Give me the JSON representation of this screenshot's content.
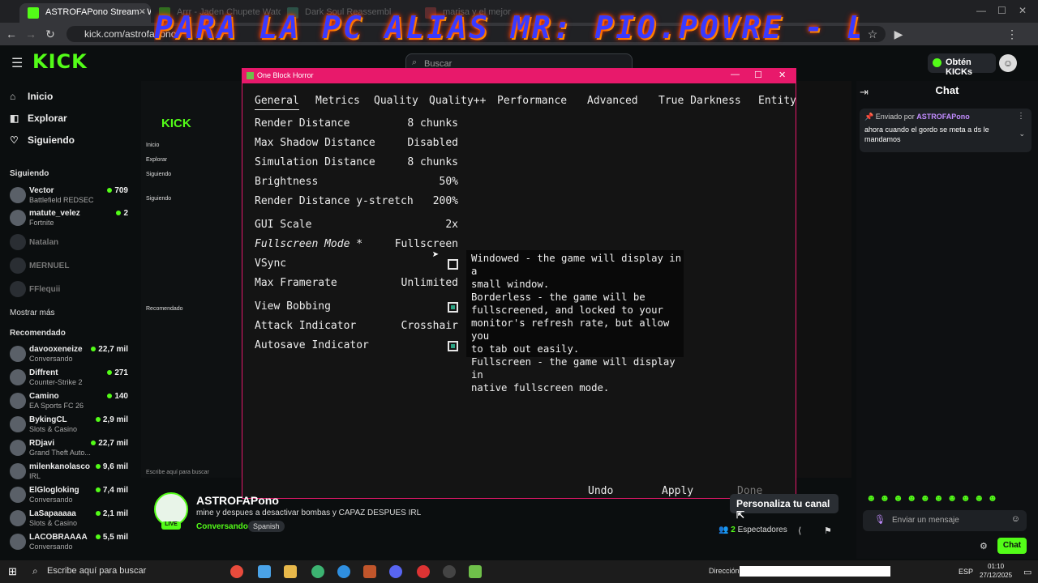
{
  "browser": {
    "tabs": [
      {
        "label": "ASTROFAPono Stream - Watch",
        "active": true
      },
      {
        "label": "Arrr - Jaden Chupete Watch",
        "active": false
      },
      {
        "label": "Dark Soul Reassembl",
        "active": false
      },
      {
        "label": "marisa y el mejor",
        "active": false
      }
    ],
    "url": "kick.com/astrofapono",
    "overlay_banner": "PARA LA PC ALIAS MR: PIO.POVRE - LEANSGIP"
  },
  "kick": {
    "logo": "KICK",
    "search_placeholder": "Buscar",
    "obtain_kicks": "Obtén KICKs",
    "nav": [
      {
        "label": "Inicio",
        "icon": "home-icon"
      },
      {
        "label": "Explorar",
        "icon": "compass-icon"
      },
      {
        "label": "Siguiendo",
        "icon": "heart-icon"
      }
    ],
    "following_header": "Siguiendo",
    "following": [
      {
        "name": "Vector",
        "game": "Battlefield REDSEC",
        "viewers": "709"
      },
      {
        "name": "matute_velez",
        "game": "Fortnite",
        "viewers": "2"
      },
      {
        "name": "Natalan",
        "game": "",
        "viewers": ""
      },
      {
        "name": "MERNUEL",
        "game": "",
        "viewers": ""
      },
      {
        "name": "FFlequii",
        "game": "",
        "viewers": ""
      }
    ],
    "show_more": "Mostrar más",
    "recommended_header": "Recomendado",
    "recommended": [
      {
        "name": "davooxeneize",
        "game": "Conversando",
        "viewers": "22,7 mil"
      },
      {
        "name": "Diffrent",
        "game": "Counter-Strike 2",
        "viewers": "271"
      },
      {
        "name": "Camino",
        "game": "EA Sports FC 26",
        "viewers": "140"
      },
      {
        "name": "BykingCL",
        "game": "Slots & Casino",
        "viewers": "2,9 mil"
      },
      {
        "name": "RDjavi",
        "game": "Grand Theft Auto...",
        "viewers": "22,7 mil"
      },
      {
        "name": "milenkanolasco",
        "game": "IRL",
        "viewers": "9,6 mil"
      },
      {
        "name": "ElGlogloking",
        "game": "Conversando",
        "viewers": "7,4 mil"
      },
      {
        "name": "LaSapaaaaa",
        "game": "Slots & Casino",
        "viewers": "2,1 mil"
      },
      {
        "name": "LACOBRAAAA",
        "game": "Conversando",
        "viewers": "5,5 mil"
      }
    ],
    "nested_search": "Escribe aquí para buscar",
    "stream": {
      "channel": "ASTROFAPono",
      "title": "mine y despues a desactivar bombas y CAPAZ DESPUES IRL",
      "category": "Conversando",
      "language": "Spanish",
      "live": "LIVE",
      "customize": "Personaliza tu canal",
      "viewers_count": "2",
      "viewers_label": "Espectadores"
    },
    "chat": {
      "header": "Chat",
      "pinned_by_label": "Enviado por",
      "pinned_by": "ASTROFAPono",
      "pinned_message": "ahora cuando el gordo se meta a ds le mandamos",
      "input_placeholder": "Enviar un mensaje",
      "send_label": "Chat"
    }
  },
  "game": {
    "window_title": "One Block Horror",
    "tabs": [
      "General",
      "Metrics",
      "Quality",
      "Quality++",
      "Performance",
      "Advanced",
      "True Darkness",
      "Entity"
    ],
    "options": [
      {
        "label": "Render Distance",
        "value": "8 chunks"
      },
      {
        "label": "Max Shadow Distance",
        "value": "Disabled"
      },
      {
        "label": "Simulation Distance",
        "value": "8 chunks"
      },
      {
        "label": "Brightness",
        "value": "50%"
      },
      {
        "label": "Render Distance y-stretch",
        "value": "200%"
      },
      {
        "label": "GUI Scale",
        "value": "2x"
      },
      {
        "label": "Fullscreen Mode *",
        "value": "Fullscreen"
      },
      {
        "label": "VSync",
        "value": ""
      },
      {
        "label": "Max Framerate",
        "value": "Unlimited"
      },
      {
        "label": "View Bobbing",
        "value": ""
      },
      {
        "label": "Attack Indicator",
        "value": "Crosshair"
      },
      {
        "label": "Autosave Indicator",
        "value": ""
      }
    ],
    "toggles": {
      "vsync": false,
      "view_bobbing": true,
      "autosave_indicator": true
    },
    "tooltip": [
      "Windowed - the game will display in a",
      "small window.",
      "Borderless - the game will be",
      "fullscreened, and locked to your",
      "monitor's refresh rate, but allow you",
      "to tab out easily.",
      "Fullscreen - the game will display in",
      "native fullscreen mode."
    ],
    "buttons": {
      "undo": "Undo",
      "apply": "Apply",
      "done": "Done"
    },
    "accent": "#e8196b"
  },
  "taskbar": {
    "search_placeholder": "Escribe aquí para buscar",
    "direction_label": "Dirección",
    "language": "ESP",
    "time": "01:10",
    "date": "27/12/2025"
  }
}
